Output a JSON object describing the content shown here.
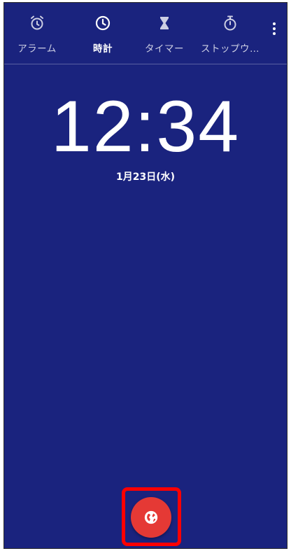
{
  "tabs": [
    {
      "id": "alarm",
      "label": "アラーム",
      "icon": "alarm-clock-icon",
      "active": false
    },
    {
      "id": "clock",
      "label": "時計",
      "icon": "clock-icon",
      "active": true
    },
    {
      "id": "timer",
      "label": "タイマー",
      "icon": "hourglass-icon",
      "active": false
    },
    {
      "id": "stopwatch",
      "label": "ストップウ…",
      "icon": "stopwatch-icon",
      "active": false
    }
  ],
  "more_menu": {
    "icon": "more-vertical-icon"
  },
  "clock": {
    "time": "12:34",
    "date": "1月23日(水)"
  },
  "fab": {
    "icon": "globe-icon",
    "color": "#e53935",
    "highlighted": true
  },
  "colors": {
    "background": "#1a237e",
    "accent": "#e53935",
    "highlight": "#ff0000"
  }
}
